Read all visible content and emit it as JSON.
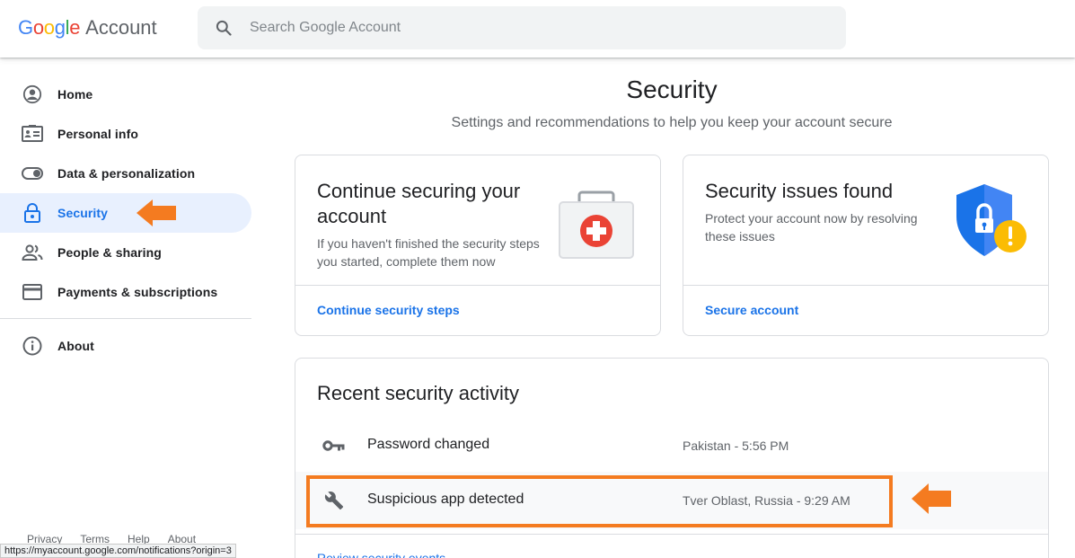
{
  "header": {
    "logo_letters": [
      "G",
      "o",
      "o",
      "g",
      "l",
      "e"
    ],
    "logo_colors": [
      "#4285F4",
      "#EA4335",
      "#FBBC05",
      "#4285F4",
      "#34A853",
      "#EA4335"
    ],
    "logo_suffix": "Account",
    "search_placeholder": "Search Google Account",
    "search_icon": "search-icon"
  },
  "sidebar": {
    "items": [
      {
        "label": "Home",
        "icon": "account-circle-icon"
      },
      {
        "label": "Personal info",
        "icon": "id-card-icon"
      },
      {
        "label": "Data & personalization",
        "icon": "toggle-icon"
      },
      {
        "label": "Security",
        "icon": "lock-icon",
        "active": true
      },
      {
        "label": "People & sharing",
        "icon": "people-icon"
      },
      {
        "label": "Payments & subscriptions",
        "icon": "credit-card-icon"
      },
      {
        "label": "About",
        "icon": "info-icon"
      }
    ],
    "footer": [
      "Privacy",
      "Terms",
      "Help",
      "About"
    ]
  },
  "status_url": "https://myaccount.google.com/notifications?origin=3",
  "main": {
    "title": "Security",
    "subtitle": "Settings and recommendations to help you keep your account secure",
    "card1": {
      "title": "Continue securing your account",
      "description": "If you haven't finished the security steps you started, complete them now",
      "link": "Continue security steps",
      "icon": "first-aid-kit-icon"
    },
    "card2": {
      "title": "Security issues found",
      "description": "Protect your account now by resolving these issues",
      "link": "Secure account",
      "icon": "shield-warning-icon"
    },
    "activity": {
      "title": "Recent security activity",
      "rows": [
        {
          "label": "Password changed",
          "meta": "Pakistan - 5:56 PM",
          "icon": "key-icon"
        },
        {
          "label": "Suspicious app detected",
          "meta": "Tver Oblast, Russia - 9:29 AM",
          "icon": "wrench-icon"
        }
      ],
      "link": "Review security events"
    }
  },
  "colors": {
    "accent": "#1a73e8",
    "active_bg": "#e8f0fe",
    "annotation": "#f47b20"
  }
}
